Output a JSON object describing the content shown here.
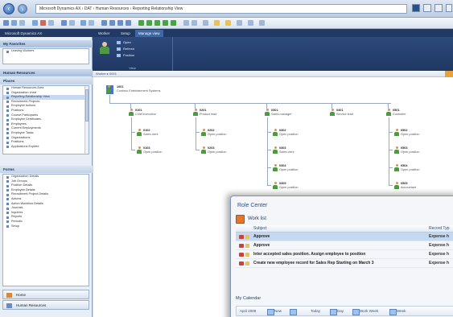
{
  "window": {
    "address": "Microsoft Dynamics AX  ›  DAT  ›  Human Resources  ›  Reporting Relationship View"
  },
  "ribbon": {
    "tabs": [
      "Microsoft Dynamics AX",
      "Worker",
      "Setup",
      "Manage view"
    ],
    "group1": {
      "items": [
        "Open",
        "Refresh",
        "Position"
      ],
      "label": "View"
    }
  },
  "leftnav": {
    "favorites_header": "My Favorites",
    "favorites_item": "Leaving Workers",
    "module_header": "Human Resources",
    "section_header": "Places",
    "places": [
      "Human Resources Area",
      "Organization chart",
      "Reporting Relationship View",
      "Recruitment Projects",
      "Employee Actions",
      "Positions",
      "Course Participants",
      "Employee Certificates",
      "Employees",
      "Current Employments",
      "Employee Tasks",
      "Organizations",
      "Positions",
      "Applications Expired"
    ],
    "section2_header": "Forms",
    "forms": [
      "Organization Details",
      "Job Groups",
      "Position Details",
      "Employee Details",
      "Recruitment Project Details",
      "Actions",
      "Action Workflow Details",
      "Journals",
      "Inquiries",
      "Reports",
      "Periodic",
      "Setup"
    ],
    "bottom_items": [
      "Home",
      "Human Resources"
    ]
  },
  "main": {
    "breadcrumb": "Worker ▸ 0001",
    "root": {
      "id": "1001",
      "title": "Contoso Entertainment Systems"
    },
    "columns": [
      {
        "head_id": "0101",
        "head_title": "Chief executive",
        "children": [
          {
            "id": "0102",
            "title": "Sales clerk"
          },
          {
            "id": "0103",
            "title": "Open position"
          }
        ]
      },
      {
        "head_id": "0201",
        "head_title": "Product lead",
        "children": [
          {
            "id": "0202",
            "title": "Open position"
          },
          {
            "id": "0203",
            "title": "Open position"
          }
        ]
      },
      {
        "head_id": "0301",
        "head_title": "Sales manager",
        "children": [
          {
            "id": "0302",
            "title": "Open position"
          },
          {
            "id": "0303",
            "title": "Sales clerk"
          },
          {
            "id": "0304",
            "title": "Open position"
          },
          {
            "id": "0305",
            "title": "Open position"
          }
        ]
      },
      {
        "head_id": "0401",
        "head_title": "Service lead",
        "children": []
      },
      {
        "head_id": "0501",
        "head_title": "Controller",
        "children": [
          {
            "id": "0502",
            "title": "Open position"
          },
          {
            "id": "0503",
            "title": "Open position"
          },
          {
            "id": "0504",
            "title": "Open position"
          },
          {
            "id": "0505",
            "title": "Accountant"
          }
        ]
      }
    ]
  },
  "role_center": {
    "title": "Role Center",
    "work_list_label": "Work list",
    "columns": {
      "subject": "Subject",
      "record_type": "Record Typ"
    },
    "rows": [
      {
        "subject": "Approve",
        "record_type": "Expense h"
      },
      {
        "subject": "Approve",
        "record_type": "Expense h"
      },
      {
        "subject": "Inter accepted sales position. Assign employee to position",
        "record_type": "Expense h"
      },
      {
        "subject": "Create new employee record for Sales Rep Starting on March 3",
        "record_type": "Expense h"
      }
    ],
    "calendar_label": "My Calendar",
    "calendar_bar": {
      "month": "April 2009",
      "new_label": "New",
      "today_label": "Today",
      "day_label": "Day",
      "work_week_label": "Work Week",
      "week_label": "Week"
    }
  }
}
